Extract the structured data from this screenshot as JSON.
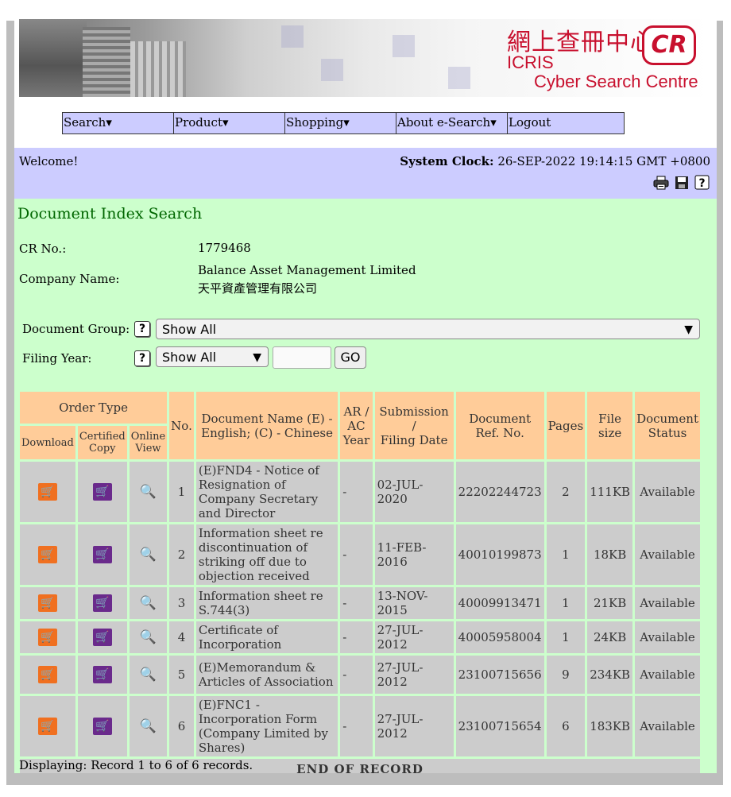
{
  "banner": {
    "chinese_title": "網上查冊中心",
    "cr_badge": "CR",
    "icris": "ICRIS",
    "subtitle": "Cyber Search Centre"
  },
  "menu": [
    {
      "label": "Search",
      "has_dropdown": true
    },
    {
      "label": "Product",
      "has_dropdown": true
    },
    {
      "label": "Shopping",
      "has_dropdown": true
    },
    {
      "label": "About e-Search",
      "has_dropdown": true
    },
    {
      "label": "Logout",
      "has_dropdown": false
    }
  ],
  "status": {
    "welcome": "Welcome!",
    "clock_label": "System Clock:",
    "clock_value": "26-SEP-2022 19:14:15 GMT +0800"
  },
  "toolbar_icons": [
    "print-icon",
    "save-icon",
    "help-icon"
  ],
  "page": {
    "heading": "Document Index Search",
    "cr_label": "CR No.:",
    "cr_value": "1779468",
    "company_label": "Company Name:",
    "company_name_en": "Balance Asset Management Limited",
    "company_name_zh": "天平資產管理有限公司"
  },
  "filters": {
    "group_label": "Document Group:",
    "group_value": "Show All",
    "year_label": "Filing Year:",
    "year_value": "Show All",
    "year_text": "",
    "go_label": "GO",
    "help_glyph": "?"
  },
  "table": {
    "order_type": "Order Type",
    "download": "Download",
    "certified_line1": "Certified",
    "certified_line2": "Copy",
    "online_line1": "Online",
    "online_line2": "View",
    "no": "No.",
    "docname_line1": "Document Name (E) -",
    "docname_line2": "English; (C) - Chinese",
    "arac_line1": "AR /",
    "arac_line2": "AC",
    "arac_line3": "Year",
    "submission_line1": "Submission /",
    "submission_line2": "Filing Date",
    "ref_line1": "Document",
    "ref_line2": "Ref. No.",
    "pages": "Pages",
    "filesize_line1": "File",
    "filesize_line2": "size",
    "status_line1": "Document",
    "status_line2": "Status",
    "rows": [
      {
        "no": "1",
        "name": "(E)FND4 - Notice of Resignation of Company Secretary and Director",
        "arac": "-",
        "date": "02-JUL-2020",
        "ref": "22202244723",
        "pages": "2",
        "size": "111KB",
        "status": "Available"
      },
      {
        "no": "2",
        "name": "Information sheet re discontinuation of striking off due to objection received",
        "arac": "-",
        "date": "11-FEB-2016",
        "ref": "40010199873",
        "pages": "1",
        "size": "18KB",
        "status": "Available"
      },
      {
        "no": "3",
        "name": "Information sheet re S.744(3)",
        "arac": "-",
        "date": "13-NOV-2015",
        "ref": "40009913471",
        "pages": "1",
        "size": "21KB",
        "status": "Available"
      },
      {
        "no": "4",
        "name": "Certificate of Incorporation",
        "arac": "-",
        "date": "27-JUL-2012",
        "ref": "40005958004",
        "pages": "1",
        "size": "24KB",
        "status": "Available"
      },
      {
        "no": "5",
        "name": "(E)Memorandum & Articles of Association",
        "arac": "-",
        "date": "27-JUL-2012",
        "ref": "23100715656",
        "pages": "9",
        "size": "234KB",
        "status": "Available"
      },
      {
        "no": "6",
        "name": "(E)FNC1 - Incorporation Form (Company Limited by Shares)",
        "arac": "-",
        "date": "27-JUL-2012",
        "ref": "23100715654",
        "pages": "6",
        "size": "183KB",
        "status": "Available"
      }
    ],
    "end_of_record": "END OF RECORD"
  },
  "footer": {
    "displaying": "Displaying: Record 1 to 6 of 6 records."
  }
}
